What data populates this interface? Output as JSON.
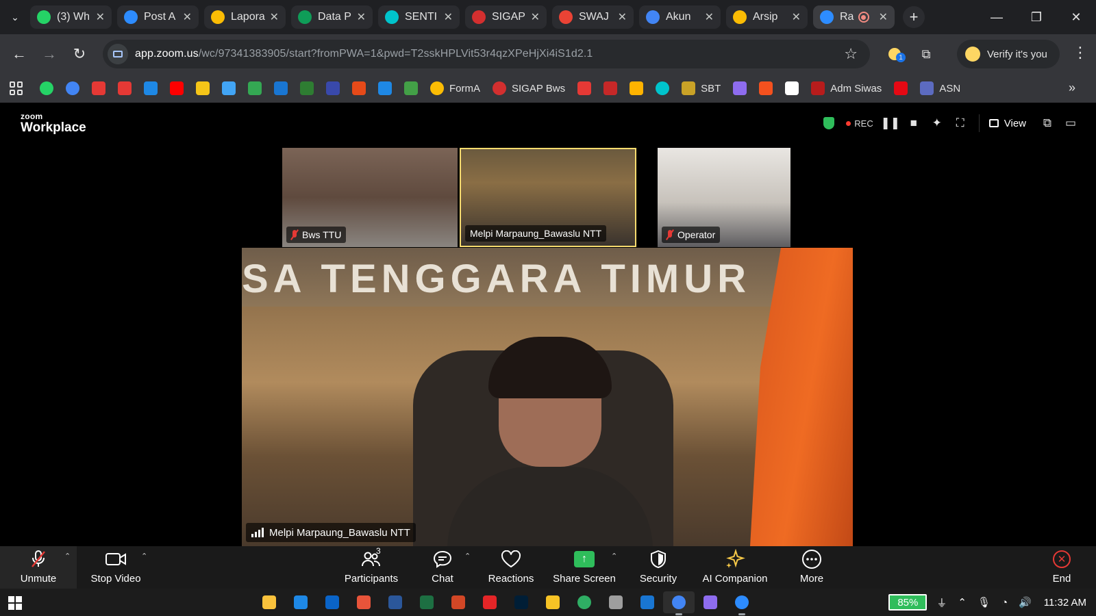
{
  "browser": {
    "tabs": [
      {
        "label": "(3) Wh",
        "icon": "whatsapp-icon",
        "color": "#25D366"
      },
      {
        "label": "Post A",
        "icon": "zoom-icon",
        "color": "#2D8CFF"
      },
      {
        "label": "Lapora",
        "icon": "google-drive-icon",
        "color": "#FBBC04"
      },
      {
        "label": "Data P",
        "icon": "google-sheets-icon",
        "color": "#0F9D58"
      },
      {
        "label": "SENTI",
        "icon": "canva-icon",
        "color": "#00C4CC"
      },
      {
        "label": "SIGAP",
        "icon": "sigap-icon",
        "color": "#D32F2F"
      },
      {
        "label": "SWAJ",
        "icon": "grid-app-icon",
        "color": "#EA4335"
      },
      {
        "label": "Akun",
        "icon": "google-icon",
        "color": "#4285F4"
      },
      {
        "label": "Arsip",
        "icon": "google-drive-icon",
        "color": "#FBBC04"
      },
      {
        "label": "Ra",
        "icon": "zoom-icon",
        "color": "#2D8CFF",
        "active": true
      }
    ],
    "url_host": "app.zoom.us",
    "url_path": "/wc/97341383905/start?fromPWA=1&pwd=T2sskHPLVit53r4qzXPeHjXi4iS1d2.1",
    "extension_badge": "1",
    "verify_label": "Verify it's you",
    "bookmarks": [
      {
        "icon": "whatsapp-icon",
        "color": "#25D366",
        "label": ""
      },
      {
        "icon": "google-icon",
        "color": "#4285F4",
        "label": ""
      },
      {
        "icon": "box-icon",
        "color": "#E53935",
        "label": ""
      },
      {
        "icon": "box-icon",
        "color": "#E53935",
        "label": ""
      },
      {
        "icon": "kite-icon",
        "color": "#1E88E5",
        "label": ""
      },
      {
        "icon": "youtube-icon",
        "color": "#FF0000",
        "label": ""
      },
      {
        "icon": "imdb-icon",
        "color": "#F5C518",
        "label": ""
      },
      {
        "icon": "script-icon",
        "color": "#42A5F5",
        "label": ""
      },
      {
        "icon": "map-icon",
        "color": "#34A853",
        "label": ""
      },
      {
        "icon": "shield-icon",
        "color": "#1976D2",
        "label": ""
      },
      {
        "icon": "flag-icon",
        "color": "#2E7D32",
        "label": ""
      },
      {
        "icon": "k-icon",
        "color": "#3949AB",
        "label": ""
      },
      {
        "icon": "card-icon",
        "color": "#E64A19",
        "label": ""
      },
      {
        "icon": "z-icon",
        "color": "#1E88E5",
        "label": ""
      },
      {
        "icon": "figure-icon",
        "color": "#43A047",
        "label": ""
      },
      {
        "icon": "google-drive-icon",
        "color": "#FBBC04",
        "label": "FormA"
      },
      {
        "icon": "sigap-icon",
        "color": "#D32F2F",
        "label": "SIGAP Bws"
      },
      {
        "icon": "check-icon",
        "color": "#E53935",
        "label": ""
      },
      {
        "icon": "emblem-icon",
        "color": "#C62828",
        "label": ""
      },
      {
        "icon": "sparkle-icon",
        "color": "#FFB300",
        "label": ""
      },
      {
        "icon": "canva-icon",
        "color": "#00C4CC",
        "label": ""
      },
      {
        "icon": "garuda-icon",
        "color": "#C9A227",
        "label": "SBT"
      },
      {
        "icon": "copilot-icon",
        "color": "#8E6CEF",
        "label": ""
      },
      {
        "icon": "pinwheel-icon",
        "color": "#F4511E",
        "label": ""
      },
      {
        "icon": "logo-icon",
        "color": "#FFFFFF",
        "label": ""
      },
      {
        "icon": "dot-icon",
        "color": "#B71C1C",
        "label": "Adm Siwas"
      },
      {
        "icon": "netflix-icon",
        "color": "#E50914",
        "label": ""
      },
      {
        "icon": "asn-icon",
        "color": "#5C6BC0",
        "label": "ASN"
      }
    ]
  },
  "zoom": {
    "brand_small": "zoom",
    "brand_large": "Workplace",
    "rec_label": "REC",
    "view_label": "View",
    "participants_tiles": [
      {
        "name": "Bws TTU",
        "muted": true
      },
      {
        "name": "Melpi Marpaung_Bawaslu NTT",
        "muted": false,
        "speaking": true
      },
      {
        "name": "Operator",
        "muted": true
      }
    ],
    "banner_text": "SA TENGGARA TIMUR",
    "main_speaker": "Melpi Marpaung_Bawaslu NTT",
    "participant_count": "3",
    "controls": {
      "unmute": "Unmute",
      "stop_video": "Stop Video",
      "participants": "Participants",
      "chat": "Chat",
      "reactions": "Reactions",
      "share_screen": "Share Screen",
      "security": "Security",
      "ai_companion": "AI Companion",
      "more": "More",
      "end": "End"
    }
  },
  "taskbar": {
    "apps": [
      {
        "icon": "file-explorer-icon",
        "color": "#F9C23C"
      },
      {
        "icon": "mail-icon",
        "color": "#1E88E5"
      },
      {
        "icon": "outlook-icon",
        "color": "#0A64C8"
      },
      {
        "icon": "office-icon",
        "color": "#E8543A"
      },
      {
        "icon": "word-icon",
        "color": "#2B579A"
      },
      {
        "icon": "excel-icon",
        "color": "#1D6F42"
      },
      {
        "icon": "powerpoint-icon",
        "color": "#D24726"
      },
      {
        "icon": "acrobat-icon",
        "color": "#E42527"
      },
      {
        "icon": "photoshop-icon",
        "color": "#001E36"
      },
      {
        "icon": "player-icon",
        "color": "#F7C325"
      },
      {
        "icon": "edge-icon",
        "color": "#2FAE64"
      },
      {
        "icon": "settings-icon",
        "color": "#9E9E9E"
      },
      {
        "icon": "gallery-icon",
        "color": "#1976D2"
      },
      {
        "icon": "chrome-icon",
        "color": "#4285F4"
      },
      {
        "icon": "copilot-icon",
        "color": "#8E6CEF"
      },
      {
        "icon": "zoom-icon",
        "color": "#2D8CFF"
      }
    ],
    "battery": "85%",
    "time": "11:32 AM"
  }
}
